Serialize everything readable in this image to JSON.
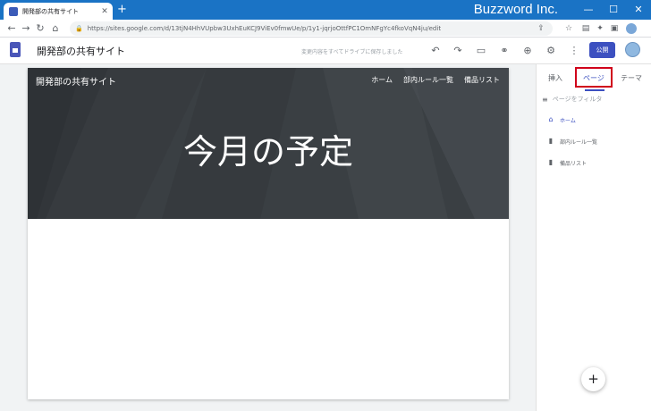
{
  "browser": {
    "tab_title": "開発部の共有サイト",
    "tab_close": "✕",
    "new_tab": "+",
    "brand": "Buzzword Inc.",
    "url": "https://sites.google.com/d/13tjN4HhVUpbw3UxhEuKCJ9ViEv0fmwUe/p/1y1-jqrjoOttfPC1OmNFgYc4fkoVqN4ju/edit",
    "controls": {
      "minimize": "—",
      "maximize": "☐",
      "close": "✕"
    },
    "nav": {
      "back": "←",
      "forward": "→",
      "reload": "↻",
      "home": "⌂"
    }
  },
  "app": {
    "site_name": "開発部の共有サイト",
    "save_status": "変更内容をすべてドライブに保存しました",
    "publish_label": "公開"
  },
  "banner": {
    "site_title": "開発部の共有サイト",
    "nav": [
      "ホーム",
      "部内ルール一覧",
      "備品リスト"
    ],
    "page_title": "今月の予定"
  },
  "panel": {
    "tabs": [
      "挿入",
      "ページ",
      "テーマ"
    ],
    "active_tab": "ページ",
    "filter_placeholder": "ページをフィルタ",
    "pages": [
      {
        "label": "ホーム",
        "icon": "home-icon",
        "active": true
      },
      {
        "label": "部内ルール一覧",
        "icon": "page-icon",
        "active": false
      },
      {
        "label": "備品リスト",
        "icon": "page-icon",
        "active": false
      }
    ],
    "fab": "+"
  },
  "colors": {
    "browser_bar": "#1a73c5",
    "accent": "#3c50c0",
    "banner_bg": "#3a3f43",
    "highlight": "#d0021b"
  }
}
